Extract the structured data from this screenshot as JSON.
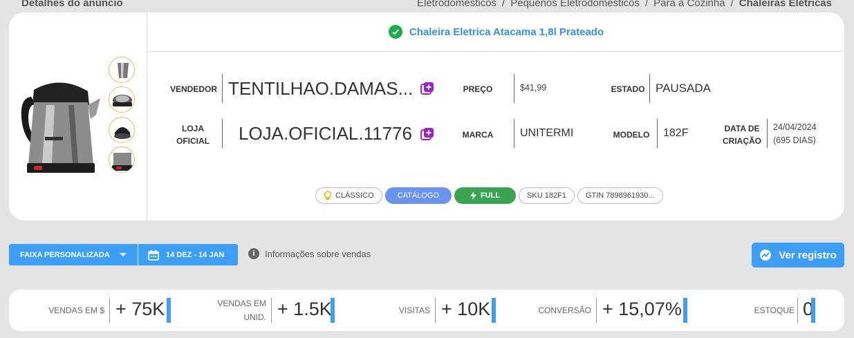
{
  "header": {
    "page_title": "Detalhes do anúncio",
    "breadcrumb": [
      "Eletrodomésticos",
      "Pequenos Eletrodomésticos",
      "Para a Cozinha",
      "Chaleiras Elétricas"
    ],
    "separator": "/"
  },
  "product": {
    "title": "Chaleira Eletrica Atacama 1,8l Prateado",
    "labels": {
      "seller": "VENDEDOR",
      "store": "LOJA OFICIAL",
      "price": "PREÇO",
      "brand": "MARCA",
      "state": "ESTADO",
      "model": "MODELO",
      "created": "DATA DE CRIAÇÃO"
    },
    "seller": "TENTILHAO.DAMAS...",
    "store": "LOJA.OFICIAL.11776",
    "price": "$41,99",
    "brand": "UNITERMI",
    "state": "PAUSADA",
    "model": "182F",
    "created_date": "24/04/2024",
    "created_days": "(695 DIAS)",
    "tags": {
      "classic": "CLÁSSICO",
      "catalog": "CATÁLOGO",
      "full": "FULL",
      "sku": "SKU 182F1",
      "gtin": "GTIN 7898961930..."
    }
  },
  "controls": {
    "range_label": "FAIXA PERSONALIZADA",
    "date_range": "14 DEZ - 14 JAN",
    "info_text": "Informações sobre vendas",
    "register_label": "Ver registro"
  },
  "stats": [
    {
      "label": "VENDAS EM $",
      "value": "+ 75K"
    },
    {
      "label": "VENDAS EM UNID.",
      "value": "+ 1.5K"
    },
    {
      "label": "VISITAS",
      "value": "+ 10K"
    },
    {
      "label": "CONVERSÃO",
      "value": "+ 15,07%"
    },
    {
      "label": "ESTOQUE",
      "value": "0"
    }
  ],
  "colors": {
    "accent": "#3d9ef5",
    "title_blue": "#3a8fd6",
    "success": "#1aad4b",
    "catalog": "#6b94f0",
    "full": "#3aa452",
    "add_icon": "#a020c8"
  }
}
